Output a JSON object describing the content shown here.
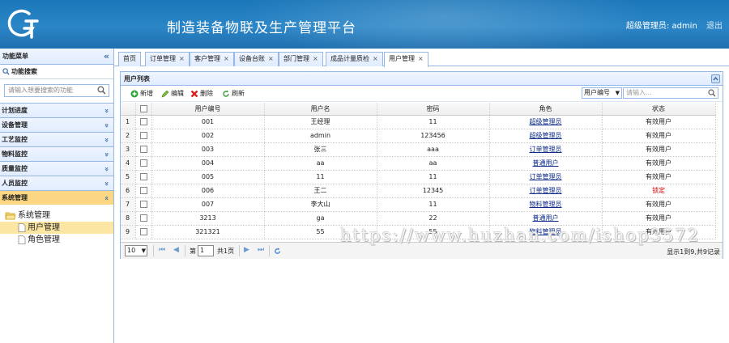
{
  "header": {
    "app_title": "制造装备物联及生产管理平台",
    "user_label": "超级管理员: admin",
    "logout_label": "退出"
  },
  "sidebar": {
    "title": "功能菜单",
    "collapse_glyph": "«",
    "search_title": "功能搜索",
    "search_placeholder": "请输入想要搜索的功能",
    "sections": [
      {
        "label": "计划进度",
        "glyph": "»"
      },
      {
        "label": "设备管理",
        "glyph": "»"
      },
      {
        "label": "工艺监控",
        "glyph": "»"
      },
      {
        "label": "物料监控",
        "glyph": "»"
      },
      {
        "label": "质量监控",
        "glyph": "»"
      },
      {
        "label": "人员监控",
        "glyph": "»"
      },
      {
        "label": "系统管理",
        "glyph": "«"
      }
    ],
    "tree": {
      "root": "系统管理",
      "children": [
        "用户管理",
        "角色管理"
      ]
    }
  },
  "tabs": [
    {
      "label": "首页"
    },
    {
      "label": "订单管理"
    },
    {
      "label": "客户管理"
    },
    {
      "label": "设备台账"
    },
    {
      "label": "部门管理"
    },
    {
      "label": "成品计量质检"
    },
    {
      "label": "用户管理"
    }
  ],
  "panel": {
    "title": "用户列表",
    "toolbar": {
      "add": "新增",
      "edit": "编辑",
      "delete": "删除",
      "refresh": "刷新"
    },
    "search_field": "用户编号",
    "search_placeholder": "请输入..."
  },
  "grid": {
    "columns": [
      "用户编号",
      "用户名",
      "密码",
      "角色",
      "状态"
    ],
    "rows": [
      {
        "n": "1",
        "id": "001",
        "name": "王经理",
        "pwd": "11",
        "role": "超级管理员",
        "status": "有效用户"
      },
      {
        "n": "2",
        "id": "002",
        "name": "admin",
        "pwd": "123456",
        "role": "超级管理员",
        "status": "有效用户"
      },
      {
        "n": "3",
        "id": "003",
        "name": "张三",
        "pwd": "aaa",
        "role": "订单管理员",
        "status": "有效用户"
      },
      {
        "n": "4",
        "id": "004",
        "name": "aa",
        "pwd": "aa",
        "role": "普通用户",
        "status": "有效用户"
      },
      {
        "n": "5",
        "id": "005",
        "name": "11",
        "pwd": "11",
        "role": "订单管理员",
        "status": "有效用户"
      },
      {
        "n": "6",
        "id": "006",
        "name": "王二",
        "pwd": "12345",
        "role": "订单管理员",
        "status": "锁定"
      },
      {
        "n": "7",
        "id": "007",
        "name": "李大山",
        "pwd": "11",
        "role": "物料管理员",
        "status": "有效用户"
      },
      {
        "n": "8",
        "id": "3213",
        "name": "ga",
        "pwd": "22",
        "role": "普通用户",
        "status": "有效用户"
      },
      {
        "n": "9",
        "id": "321321",
        "name": "55",
        "pwd": "55",
        "role": "物料管理员",
        "status": "有效用户"
      }
    ]
  },
  "pager": {
    "page_size": "10",
    "page_prefix": "第",
    "current_page": "1",
    "page_suffix": "共1页",
    "info": "显示1到9,共9记录"
  },
  "watermark": "https://www.huzhan.com/ishop3572",
  "colors": {
    "header": "#2b86c7",
    "border": "#95b8e7",
    "active_section": "#fcd783",
    "locked": "#cc0000"
  }
}
